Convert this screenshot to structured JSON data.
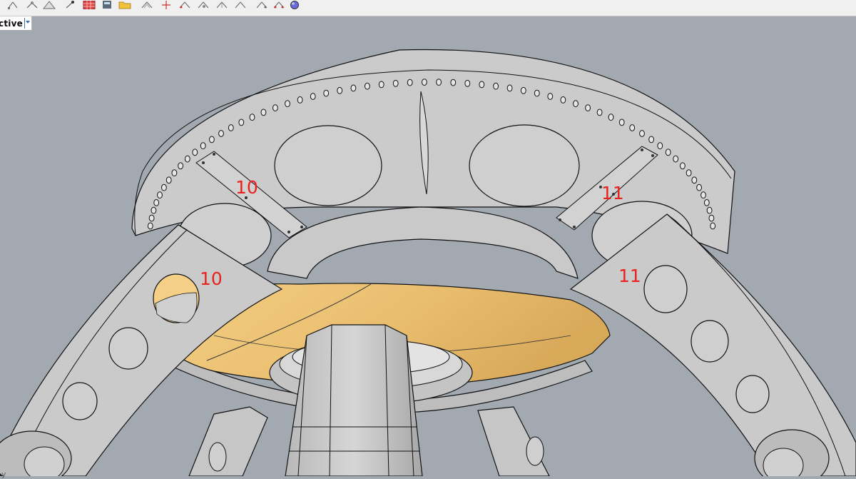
{
  "toolbar": {
    "icons": [
      "cplane-icon",
      "cplane-world-icon",
      "grid-icon",
      "calculator-icon",
      "open-folder-icon",
      "cplane-elevation-icon",
      "point-icon",
      "snap-icon",
      "cplane-rotate-icon",
      "cplane-3point-icon",
      "cplane-object-icon",
      "cplane-view-icon",
      "cplane-undo-icon",
      "render-sphere-icon"
    ]
  },
  "viewport": {
    "tab_label": "ctive",
    "axis_label": "y"
  },
  "annotations": {
    "left_bracket_label": "10",
    "left_leg_label": "10",
    "right_bracket_label": "11",
    "right_leg_label": "11"
  },
  "colors": {
    "background": "#a2a9b0",
    "model_gray": "#c9c9c9",
    "model_gold": "#efc77a",
    "annotation_red": "#e8231f",
    "outline": "#111111"
  }
}
